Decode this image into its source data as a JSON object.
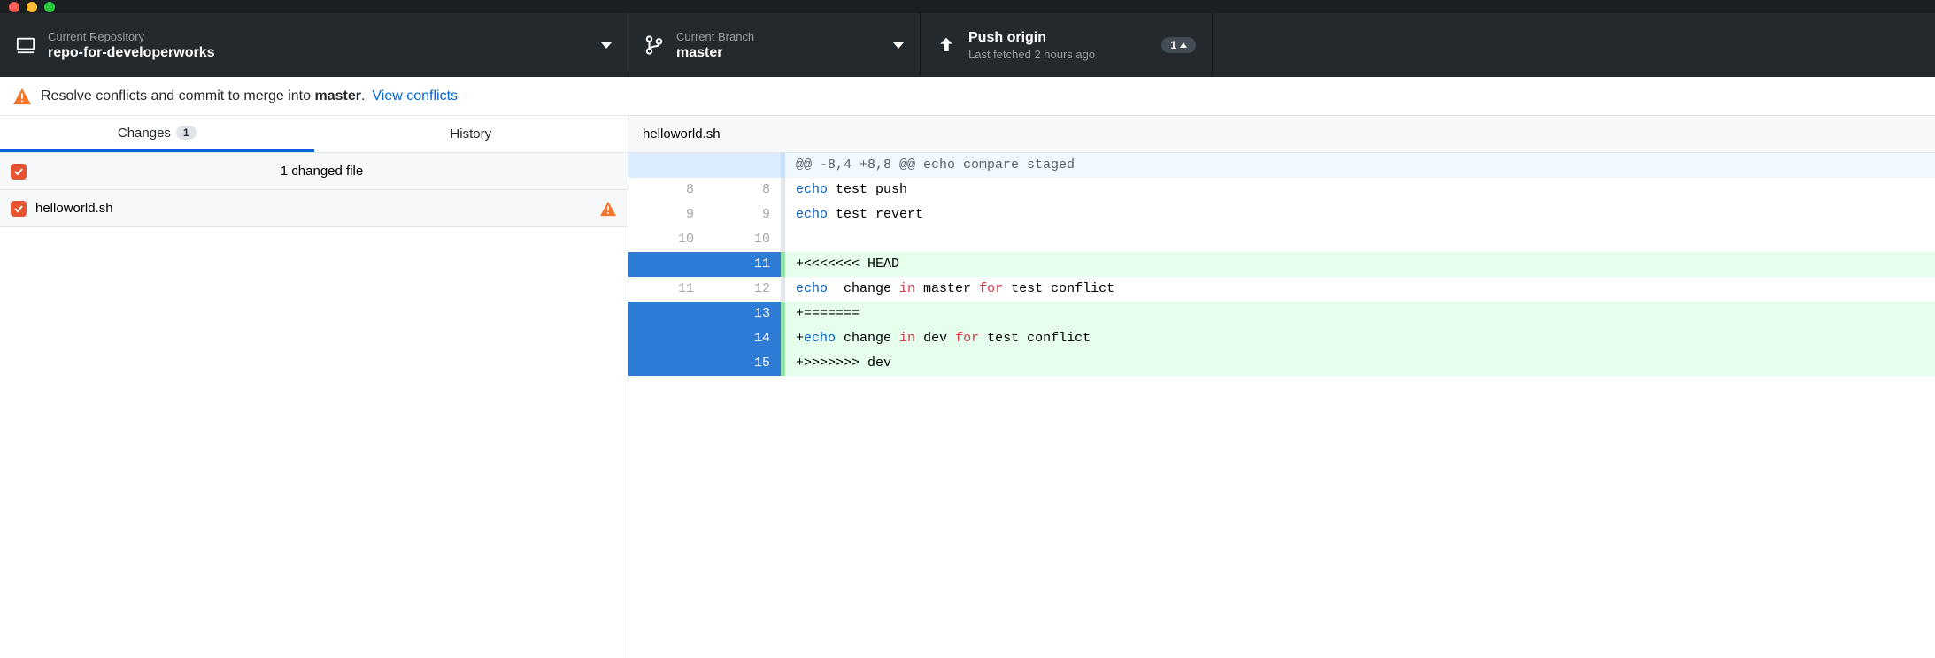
{
  "toolbar": {
    "repo": {
      "label": "Current Repository",
      "value": "repo-for-developerworks"
    },
    "branch": {
      "label": "Current Branch",
      "value": "master"
    },
    "push": {
      "label": "Push origin",
      "sub": "Last fetched 2 hours ago",
      "badge_count": "1"
    }
  },
  "banner": {
    "prefix": "Resolve conflicts and commit to merge into ",
    "target": "master",
    "suffix": ".",
    "link": "View conflicts"
  },
  "tabs": {
    "changes": {
      "label": "Changes",
      "count": "1"
    },
    "history": {
      "label": "History"
    }
  },
  "changes": {
    "header": "1 changed file",
    "files": [
      {
        "name": "helloworld.sh"
      }
    ]
  },
  "diff": {
    "filename": "helloworld.sh",
    "hunk": "@@ -8,4 +8,8 @@ echo compare staged",
    "lines": [
      {
        "old": "8",
        "new": "8",
        "type": "ctx",
        "tokens": [
          [
            "kw",
            "echo"
          ],
          [
            "txt",
            " test push"
          ]
        ]
      },
      {
        "old": "9",
        "new": "9",
        "type": "ctx",
        "tokens": [
          [
            "kw",
            "echo"
          ],
          [
            "txt",
            " test revert"
          ]
        ]
      },
      {
        "old": "10",
        "new": "10",
        "type": "ctx",
        "tokens": []
      },
      {
        "old": "",
        "new": "11",
        "type": "added-sel",
        "tokens": [
          [
            "txt",
            "+<<<<<<< HEAD"
          ]
        ]
      },
      {
        "old": "11",
        "new": "12",
        "type": "ctx",
        "tokens": [
          [
            "kw",
            "echo"
          ],
          [
            "txt",
            "  change "
          ],
          [
            "in",
            "in"
          ],
          [
            "txt",
            " master "
          ],
          [
            "for",
            "for"
          ],
          [
            "txt",
            " test conflict"
          ]
        ]
      },
      {
        "old": "",
        "new": "13",
        "type": "added-sel",
        "tokens": [
          [
            "txt",
            "+======="
          ]
        ]
      },
      {
        "old": "",
        "new": "14",
        "type": "added-sel",
        "tokens": [
          [
            "txt",
            "+"
          ],
          [
            "kw",
            "echo"
          ],
          [
            "txt",
            " change "
          ],
          [
            "in",
            "in"
          ],
          [
            "txt",
            " dev "
          ],
          [
            "for",
            "for"
          ],
          [
            "txt",
            " test conflict"
          ]
        ]
      },
      {
        "old": "",
        "new": "15",
        "type": "added-sel",
        "tokens": [
          [
            "txt",
            "+>>>>>>> dev"
          ]
        ]
      }
    ]
  }
}
